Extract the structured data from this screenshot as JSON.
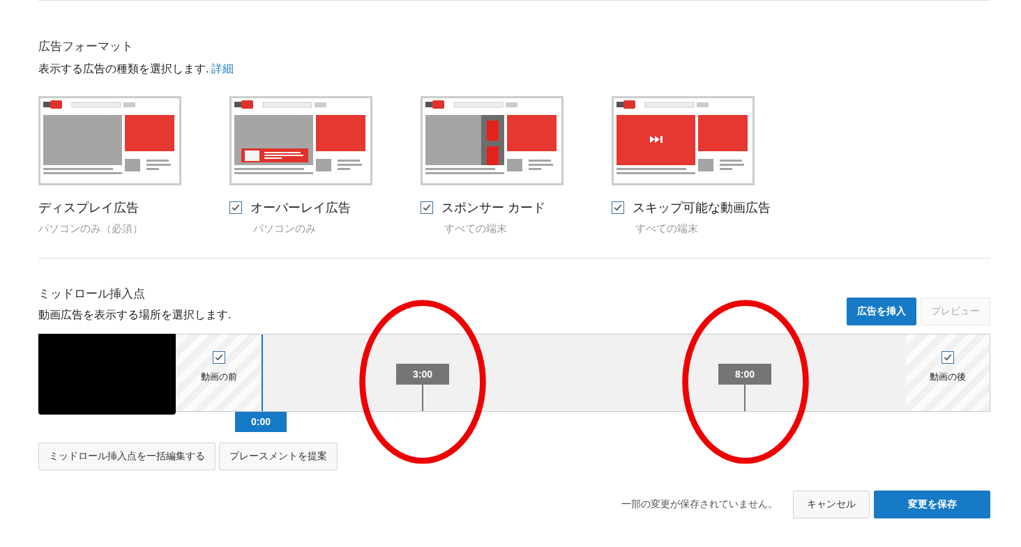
{
  "ad_formats": {
    "title": "広告フォーマット",
    "description": "表示する広告の種類を選択します.",
    "details_link": "詳細",
    "items": [
      {
        "kind": "display",
        "label": "ディスプレイ広告",
        "note": "パソコンのみ（必須）"
      },
      {
        "kind": "overlay",
        "label": "オーバーレイ広告",
        "note": "パソコンのみ",
        "checked": true
      },
      {
        "kind": "sponsor",
        "label": "スポンサー カード",
        "note": "すべての端末",
        "checked": true
      },
      {
        "kind": "skippable",
        "label": "スキップ可能な動画広告",
        "note": "すべての端末",
        "checked": true
      }
    ]
  },
  "midroll": {
    "title": "ミッドロール挿入点",
    "description": "動画広告を表示する場所を選択します.",
    "insert_button": "広告を挿入",
    "preview_button": {
      "label": "プレビュー",
      "disabled": true
    },
    "timeline": {
      "before": {
        "label": "動画の前",
        "checked": true
      },
      "after": {
        "label": "動画の後",
        "checked": true
      },
      "playhead": "0:00",
      "markers": [
        {
          "time": "3:00",
          "circled": true
        },
        {
          "time": "8:00",
          "circled": true
        }
      ]
    },
    "buttons": [
      "ミッドロール挿入点を一括編集する",
      "プレースメントを提案"
    ]
  },
  "footer": {
    "status": "一部の変更が保存されていません。",
    "cancel": "キャンセル",
    "save": "変更を保存"
  }
}
